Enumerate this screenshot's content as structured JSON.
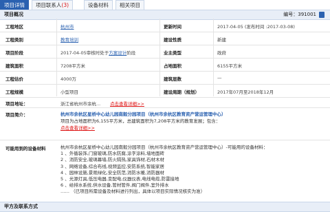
{
  "tabs": [
    {
      "label": "项目详情",
      "active": true
    },
    {
      "label": "项目联系人",
      "count": "(3)",
      "active": false
    },
    {
      "label": "设备材料",
      "active": false
    },
    {
      "label": "相关项目",
      "active": false
    }
  ],
  "overview": {
    "title": "项目概况",
    "number": "编号：391001",
    "rows": [
      {
        "l1": "工程地区",
        "v1": "杭州市",
        "l2": "更新时间",
        "v2": "2017-04-05 (发布时间 :2017-03-08)"
      },
      {
        "l1": "工程类别",
        "v1": "教育培训",
        "l2": "建设性质",
        "v2": "新建"
      },
      {
        "l1": "项目阶段",
        "v1a": "2017-04-05审核时处于",
        "v1b": "方案设计",
        "v1c": "阶段",
        "l2": "业主类型",
        "v2": "政府"
      },
      {
        "l1": "建筑面积",
        "v1": "7208平方米",
        "l2": "占地面积",
        "v2": "6155平方米"
      },
      {
        "l1": "工程估价",
        "v1": "4000万",
        "l2": "建筑层数",
        "v2": "—"
      },
      {
        "l1": "工程规模",
        "v1": "小型项目",
        "l2": "建设周期（规划）",
        "v2": "2017年07月至2018年12月"
      }
    ],
    "address": {
      "label": "项目地址：",
      "value": "浙江省杭州市余杭...",
      "link": "点击查看详细>>"
    },
    "intro": {
      "label": "项目简介：",
      "title": "杭州市余杭区星桥中心幼儿园南毅分园项目（杭州市余杭区教育资产营运管理中心）",
      "desc": "项目为占地面积为6,155平方米，总建筑面积为7,208平方米的教育发展；包含：",
      "link": "点击查看详细>>"
    },
    "equipment": {
      "label": "可能用到的设备材料",
      "intro": "杭州市余杭区星桥中心幼儿园南毅分园项目（杭州市余杭区教育资产营运管理中心）-可能用的设备材料：",
      "items": [
        "1 、外循装饰,门窗玻璃,防水防腐,涂字涂料,墙地面砖",
        "2 、消防安全,玻璃幕墙,防火隔热,家具饰材,石材木材",
        "3 、网络设备,综合布线,视频监控,安防系统,智能家居",
        "4 、园林设施,景观绿化,安全防范,消防水暖,消防器材",
        "5 、光源灯具,低压电器,变配电,仪器仪表,电线电缆,防雷接地",
        "6 、给排水系统,供水设备,管材管件,阀门阀件,室外排水"
      ],
      "note": "…… （已项目所需设备及材料进行列出，具体以项目实际情况核实为准）"
    }
  },
  "contacts_section": {
    "title": "甲方及联系方式"
  }
}
